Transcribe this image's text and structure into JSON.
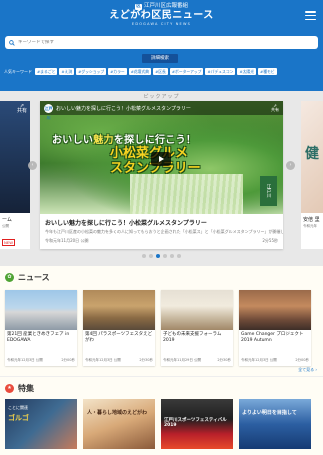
{
  "header": {
    "brand_top": "江戸川区広報番組",
    "brand_badge": "区",
    "title": "えどがわ区民ニュース",
    "subtitle": "EDOGAWA CITY NEWS"
  },
  "search": {
    "placeholder": "キーワードで探す",
    "detail_label": "詳細検索",
    "keywords_label": "人気キーワード",
    "keywords": [
      "#まるごと",
      "#え渕",
      "#グッショップ",
      "#カラー",
      "#花壇式典",
      "#区長",
      "#ボーターアップ",
      "#パデュスコン",
      "#太陽光",
      "#種モビ"
    ]
  },
  "carousel": {
    "label": "ピックアップ",
    "left": {
      "title": "ーム",
      "date": "公開",
      "tag": "NEW",
      "share": "共有"
    },
    "main": {
      "bar_logo": "江戸川",
      "bar_title": "おいしい魅力を探しに行こう！小松菜グルメスタンプラリー",
      "share": "共有",
      "headline_pre": "おいしい",
      "headline_hl": "魅力",
      "headline_post": "を探しに行こう！",
      "headline2_line1": "小松菜グルメ",
      "headline2_line2": "スタンプラリー",
      "badge": "江戸川",
      "title": "おいしい魅力を探しに行こう！小松菜グルメスタンプラリー",
      "desc": "今年も江戸川区産の小松菜の魅力を多くの人に知ってもらおうと企画された「小松菜ス」と「小松菜グルメスタンプラリー」が開催し...",
      "date": "令和元年11月20日 公開",
      "duration": "2分55秒"
    },
    "right": {
      "text": "健",
      "title": "安倍 里",
      "date": "令和元年"
    },
    "prev": "‹",
    "next": "›"
  },
  "news": {
    "heading": "ニュース",
    "see_all": "全て見る ›",
    "items": [
      {
        "title": "第21回 産業ときめきフェア in EDOGAWA",
        "date": "令和元年12月3日 公開",
        "duration": "2分00秒"
      },
      {
        "title": "第4回 パラスポーツフェスタえどがわ",
        "date": "令和元年12月3日 公開",
        "duration": "2分30秒"
      },
      {
        "title": "子どもの未来支援フォーラム2019",
        "date": "令和元年11月29日 公開",
        "duration": "2分30秒"
      },
      {
        "title": "Game Changer プロジェクト 2019 Autumn",
        "date": "令和元年12月3日 公開",
        "duration": "2分00秒"
      }
    ]
  },
  "feature": {
    "heading": "特集",
    "items": [
      {
        "caption": "ことに関連",
        "name": "ゴルゴ"
      },
      {
        "caption": "人・暮らし地域のえどがわ"
      },
      {
        "caption": "江戸川スポーツフェスティバル 2019"
      },
      {
        "caption": "よりよい明日を目指して"
      }
    ]
  },
  "colors": {
    "primary": "#1a75c8",
    "news_icon": "#4fa335",
    "feature_icon": "#e94b3c"
  }
}
